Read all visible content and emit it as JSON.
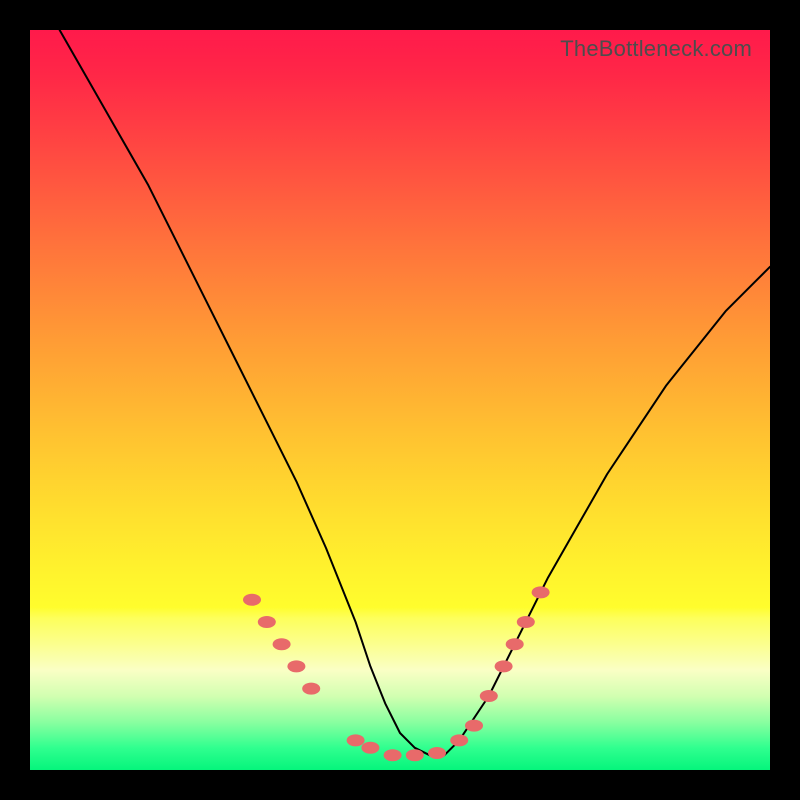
{
  "watermark": "TheBottleneck.com",
  "gradient": {
    "stops": [
      {
        "offset": 0.0,
        "color": "#ff1a4b"
      },
      {
        "offset": 0.06,
        "color": "#ff2747"
      },
      {
        "offset": 0.12,
        "color": "#ff3a44"
      },
      {
        "offset": 0.18,
        "color": "#ff4e41"
      },
      {
        "offset": 0.24,
        "color": "#ff623e"
      },
      {
        "offset": 0.3,
        "color": "#ff763b"
      },
      {
        "offset": 0.36,
        "color": "#ff8938"
      },
      {
        "offset": 0.42,
        "color": "#ff9c35"
      },
      {
        "offset": 0.48,
        "color": "#ffae33"
      },
      {
        "offset": 0.54,
        "color": "#ffc031"
      },
      {
        "offset": 0.6,
        "color": "#ffd12f"
      },
      {
        "offset": 0.66,
        "color": "#ffe12e"
      },
      {
        "offset": 0.72,
        "color": "#fff02d"
      },
      {
        "offset": 0.78,
        "color": "#fffd2d"
      },
      {
        "offset": 0.795,
        "color": "#fdff5c"
      },
      {
        "offset": 0.83,
        "color": "#fbff8e"
      },
      {
        "offset": 0.865,
        "color": "#faffc5"
      },
      {
        "offset": 0.9,
        "color": "#d2ffb1"
      },
      {
        "offset": 0.935,
        "color": "#8affa0"
      },
      {
        "offset": 0.97,
        "color": "#30ff8f"
      },
      {
        "offset": 1.0,
        "color": "#05f57c"
      }
    ]
  },
  "chart_data": {
    "type": "line",
    "title": "",
    "xlabel": "",
    "ylabel": "",
    "xlim": [
      0,
      100
    ],
    "ylim": [
      0,
      100
    ],
    "series": [
      {
        "name": "bottleneck-curve",
        "x": [
          4,
          8,
          12,
          16,
          20,
          24,
          28,
          32,
          36,
          40,
          42,
          44,
          46,
          48,
          50,
          52,
          54,
          56,
          58,
          62,
          66,
          70,
          74,
          78,
          82,
          86,
          90,
          94,
          98,
          100
        ],
        "y": [
          100,
          93,
          86,
          79,
          71,
          63,
          55,
          47,
          39,
          30,
          25,
          20,
          14,
          9,
          5,
          3,
          2,
          2,
          4,
          10,
          18,
          26,
          33,
          40,
          46,
          52,
          57,
          62,
          66,
          68
        ]
      }
    ],
    "markers": {
      "name": "highlight-dots",
      "color": "#e86a6a",
      "points": [
        {
          "x": 30,
          "y": 23
        },
        {
          "x": 32,
          "y": 20
        },
        {
          "x": 34,
          "y": 17
        },
        {
          "x": 36,
          "y": 14
        },
        {
          "x": 38,
          "y": 11
        },
        {
          "x": 44,
          "y": 4
        },
        {
          "x": 46,
          "y": 3
        },
        {
          "x": 49,
          "y": 2
        },
        {
          "x": 52,
          "y": 2
        },
        {
          "x": 55,
          "y": 2.3
        },
        {
          "x": 58,
          "y": 4
        },
        {
          "x": 60,
          "y": 6
        },
        {
          "x": 62,
          "y": 10
        },
        {
          "x": 64,
          "y": 14
        },
        {
          "x": 65.5,
          "y": 17
        },
        {
          "x": 67,
          "y": 20
        },
        {
          "x": 69,
          "y": 24
        }
      ]
    }
  }
}
